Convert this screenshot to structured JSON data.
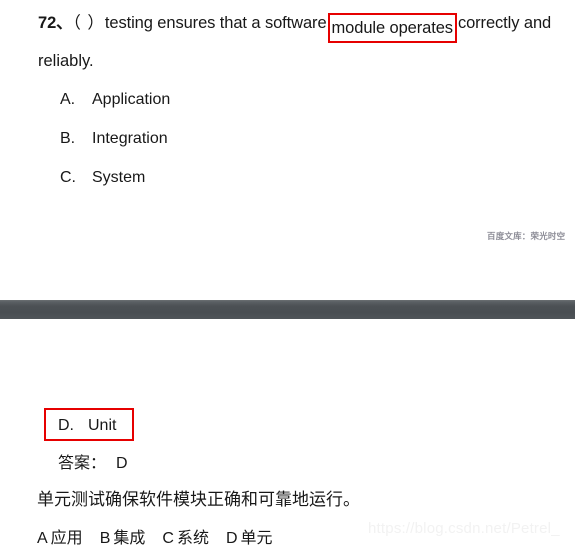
{
  "document": {
    "top_page": {
      "question": {
        "number": "72、",
        "blank_paren": "（ ）",
        "text_before_highlight": "testing ensures that a software",
        "highlighted_text": "module operates",
        "text_after_highlight": "correctly and",
        "continuation_line": "reliably."
      },
      "choices": [
        {
          "letter": "A.",
          "label": "Application"
        },
        {
          "letter": "B.",
          "label": "Integration"
        },
        {
          "letter": "C.",
          "label": "System"
        }
      ],
      "watermark": "百度文库：荣光时空"
    },
    "bottom_page": {
      "boxed_choice": {
        "letter": "D.",
        "label": "Unit"
      },
      "answer": {
        "label": "答案：",
        "value": "D"
      },
      "explanation": "单元测试确保软件模块正确和可靠地运行。",
      "cn_options": [
        {
          "letter": "A",
          "label": "应用"
        },
        {
          "letter": "B",
          "label": "集成"
        },
        {
          "letter": "C",
          "label": "系统"
        },
        {
          "letter": "D",
          "label": "单元"
        }
      ],
      "watermark": "https://blog.csdn.net/Petrel_"
    },
    "colors": {
      "highlight_red": "#e60000",
      "divider_dark": "#4c5155",
      "watermark_gray": "#8c8c96",
      "csdn_watermark": "#f2f2f2"
    }
  }
}
